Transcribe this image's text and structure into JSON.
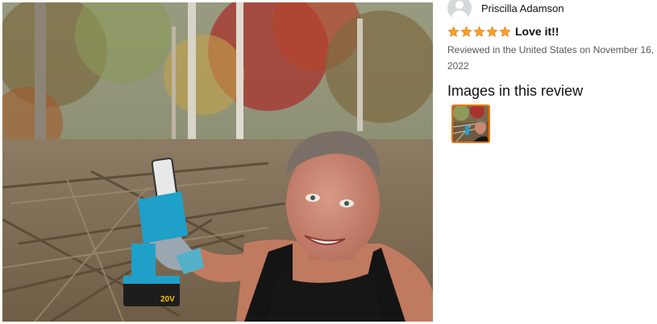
{
  "review": {
    "reviewer_name": "Priscilla Adamson",
    "rating": 5,
    "title": "Love it!!",
    "date_line": "Reviewed in the United States on November 16, 2022",
    "images_heading": "Images in this review",
    "thumbnail_count": 1,
    "colors": {
      "star": "#ffa41c",
      "star_outline": "#de7921",
      "selected_border": "#e77600"
    },
    "icons": {
      "avatar": "avatar-icon",
      "star": "star-icon"
    },
    "photo_text": {
      "battery_label": "20V"
    }
  }
}
